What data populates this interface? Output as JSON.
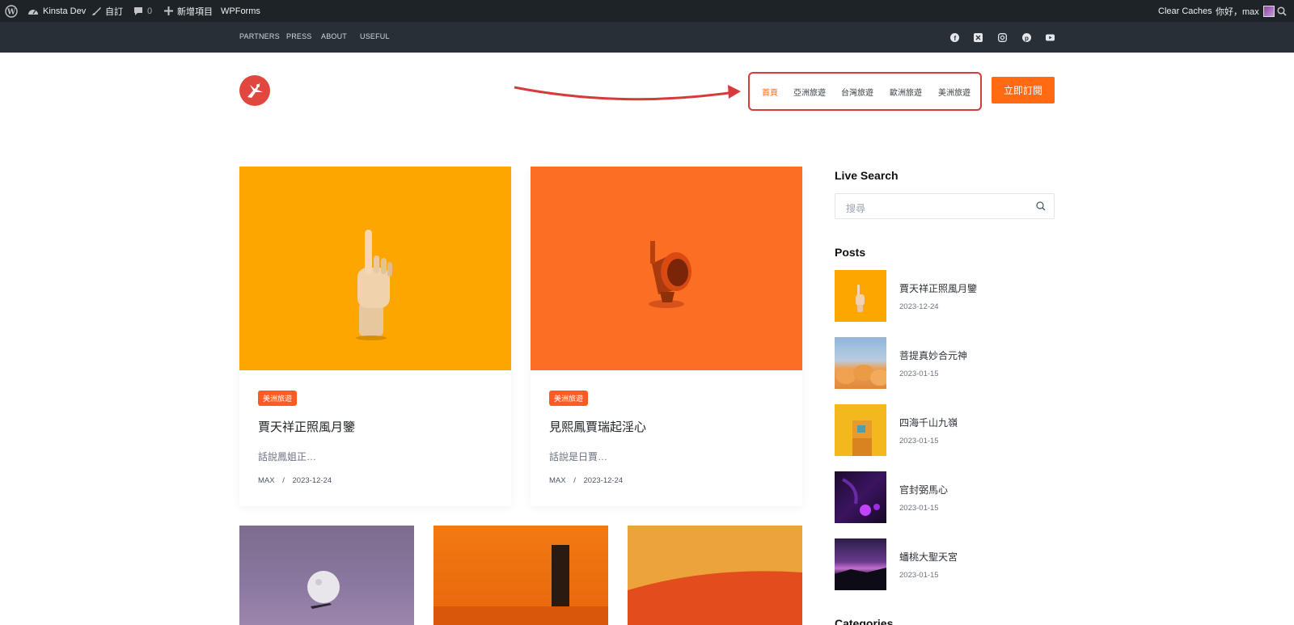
{
  "adminbar": {
    "site_name": "Kinsta Dev",
    "customize": "自訂",
    "comments_count": "0",
    "new_item": "新增項目",
    "wpforms": "WPForms",
    "clear_caches": "Clear Caches",
    "greeting": "你好，max"
  },
  "topnav": [
    "PARTNERS",
    "PRESS",
    "ABOUT",
    "USEFUL"
  ],
  "social": [
    "facebook-icon",
    "x-icon",
    "instagram-icon",
    "pinterest-icon",
    "youtube-icon"
  ],
  "mainnav": {
    "items": [
      "首頁",
      "亞洲旅遊",
      "台灣旅遊",
      "歐洲旅遊",
      "美洲旅遊"
    ],
    "active": "首頁",
    "subscribe": "立即訂閱"
  },
  "posts": [
    {
      "category": "美洲旅遊",
      "title": "賈天祥正照風月鑒",
      "excerpt": "話說鳳姐正…",
      "author": "MAX",
      "sep": "/",
      "date": "2023-12-24"
    },
    {
      "category": "美洲旅遊",
      "title": "見熙鳳賈瑞起淫心",
      "excerpt": "話說是日賈…",
      "author": "MAX",
      "sep": "/",
      "date": "2023-12-24"
    }
  ],
  "sidebar": {
    "live_search_title": "Live Search",
    "search_placeholder": "搜尋",
    "posts_title": "Posts",
    "posts": [
      {
        "title": "賈天祥正照風月鑒",
        "date": "2023-12-24"
      },
      {
        "title": "菩提真妙合元神",
        "date": "2023-01-15"
      },
      {
        "title": "四海千山九嶺",
        "date": "2023-01-15"
      },
      {
        "title": "官封弼馬心",
        "date": "2023-01-15"
      },
      {
        "title": "蟠桃大聖天宮",
        "date": "2023-01-15"
      }
    ],
    "categories_title": "Categories"
  },
  "colors": {
    "accent": "#ff6a13",
    "admin_bar": "#1d2327",
    "top_bar": "#292f36",
    "annotation_red": "#d63b3b"
  }
}
